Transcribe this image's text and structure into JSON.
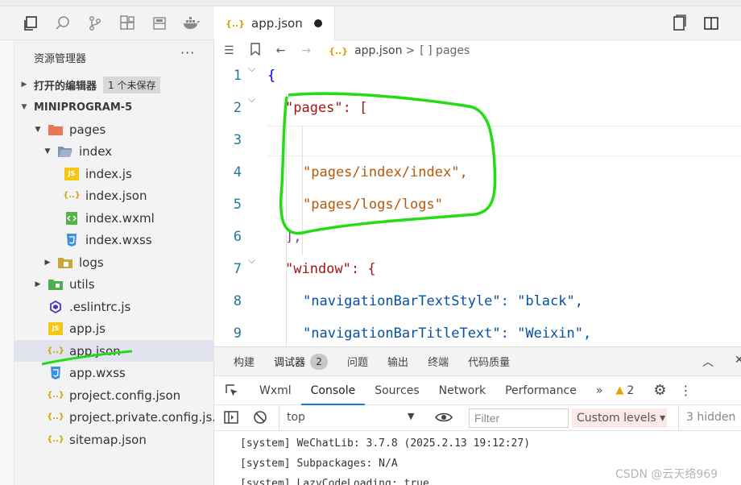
{
  "sidebar": {
    "title": "资源管理器",
    "more": "···",
    "open_editors_label": "打开的编辑器",
    "unsaved_badge": "1 个未保存",
    "project_label": "MINIPROGRAM-5",
    "tree": [
      {
        "name": "pages"
      },
      {
        "name": "index"
      },
      {
        "name": "index.js"
      },
      {
        "name": "index.json"
      },
      {
        "name": "index.wxml"
      },
      {
        "name": "index.wxss"
      },
      {
        "name": "logs"
      },
      {
        "name": "utils"
      },
      {
        "name": ".eslintrc.js"
      },
      {
        "name": "app.js"
      },
      {
        "name": "app.json"
      },
      {
        "name": "app.wxss"
      },
      {
        "name": "project.config.json"
      },
      {
        "name": "project.private.config.js..."
      },
      {
        "name": "sitemap.json"
      }
    ]
  },
  "editor": {
    "tab_label": "app.json",
    "breadcrumb_file": "app.json",
    "breadcrumb_sep": ">",
    "breadcrumb_node": "[ ] pages",
    "lines": [
      {
        "no": "1",
        "code": "{"
      },
      {
        "no": "2",
        "code": "\"pages\": ["
      },
      {
        "no": "3",
        "code": ""
      },
      {
        "no": "4",
        "code": "\"pages/index/index\","
      },
      {
        "no": "5",
        "code": "\"pages/logs/logs\""
      },
      {
        "no": "6",
        "code": "],"
      },
      {
        "no": "7",
        "code": "\"window\": {"
      },
      {
        "no": "8",
        "code": "\"navigationBarTextStyle\": \"black\","
      },
      {
        "no": "9",
        "code": "\"navigationBarTitleText\": \"Weixin\","
      }
    ]
  },
  "devtools": {
    "top_tabs": [
      "构建",
      "调试器",
      "问题",
      "输出",
      "终端",
      "代码质量"
    ],
    "debugger_badge": "2",
    "panel_tabs": [
      "Wxml",
      "Console",
      "Sources",
      "Network",
      "Performance"
    ],
    "more_tabs": "»",
    "warning_count": "2",
    "context": "top",
    "filter_placeholder": "Filter",
    "levels_label": "Custom levels ▾",
    "hidden_label": "3 hidden",
    "logs": [
      "[system] WeChatLib: 3.7.8 (2025.2.13 19:12:27)",
      "[system] Subpackages: N/A",
      "[system] LazyCodeLoading: true"
    ]
  },
  "watermark": "CSDN @云天络969",
  "colors": {
    "annotation": "#22dd11",
    "selected_row": "#e1e4ee"
  }
}
